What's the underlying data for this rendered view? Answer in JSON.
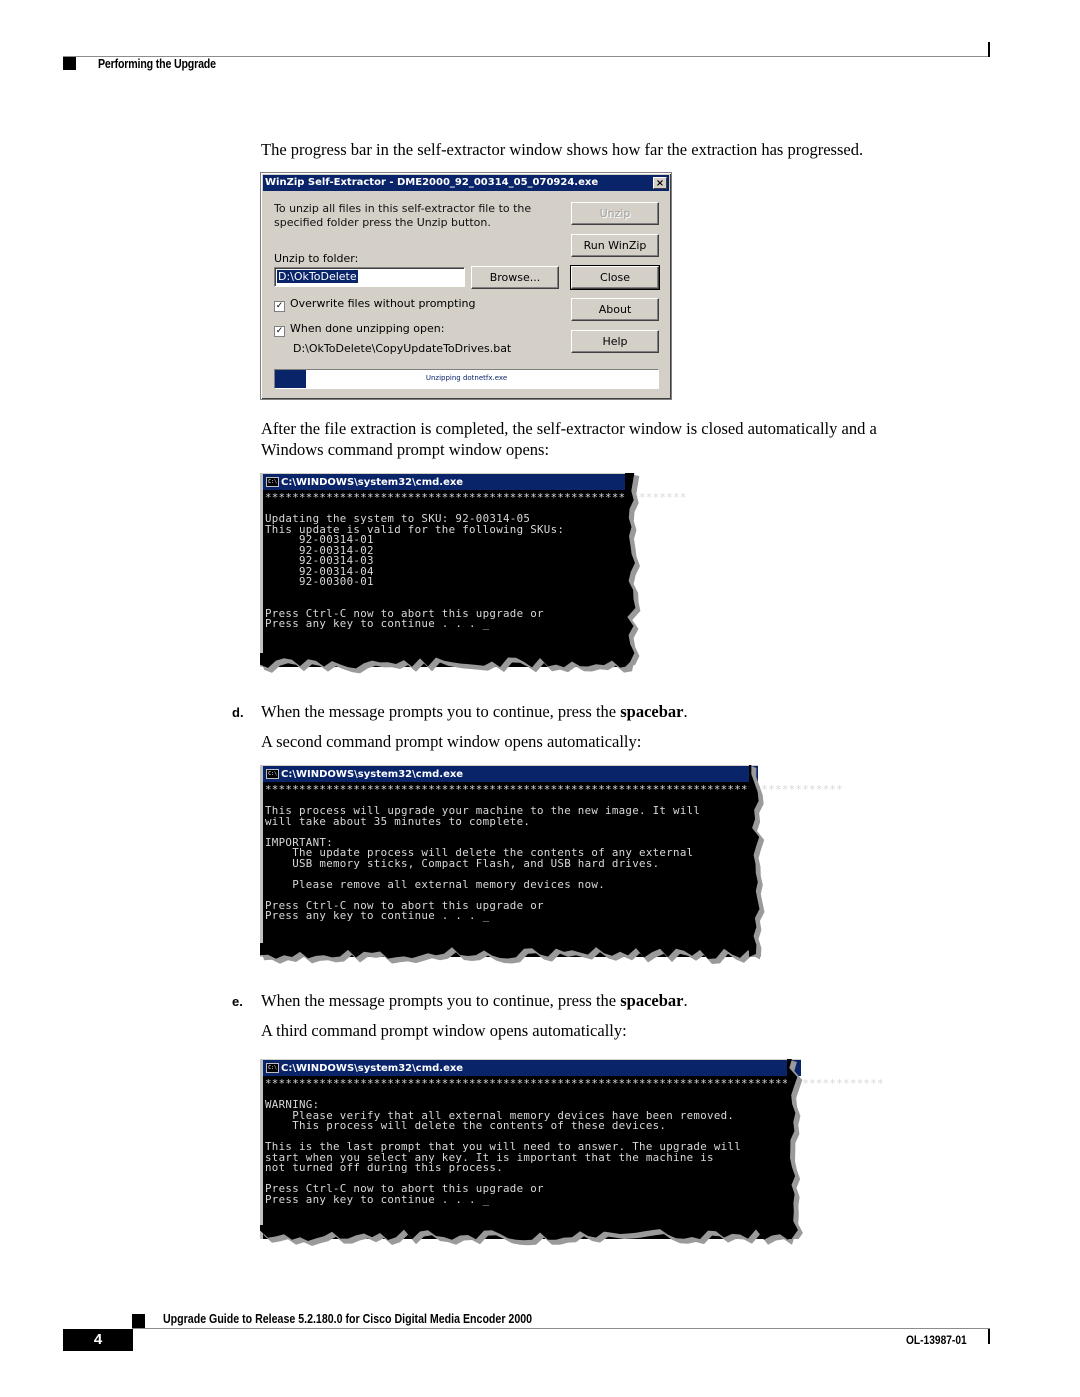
{
  "header": {
    "section_title": "Performing the Upgrade"
  },
  "intro_paragraph": "The progress bar in the self-extractor window shows how far the extraction has progressed.",
  "winzip_dialog": {
    "title": "WinZip Self-Extractor - DME2000_92_00314_05_070924.exe",
    "close_glyph": "×",
    "instruction_line1": "To unzip all files in this self-extractor file to the",
    "instruction_line2": "specified folder press the Unzip button.",
    "folder_label": "Unzip to folder:",
    "folder_value": "D:\\OkToDelete",
    "browse_label": "Browse...",
    "buttons": {
      "unzip": "Unzip",
      "run_winzip": "Run WinZip",
      "close": "Close",
      "about": "About",
      "help": "Help"
    },
    "overwrite_label": "Overwrite files without prompting",
    "overwrite_checked": true,
    "when_done_label": "When done unzipping open:",
    "when_done_checked": true,
    "check_glyph": "✓",
    "open_path": "D:\\OkToDelete\\CopyUpdateToDrives.bat",
    "progress_text": "Unzipping dotnetfx.exe",
    "progress_percent": 8,
    "colors": {
      "titlebar": "#0a246a",
      "face": "#d4d0c8"
    }
  },
  "after_extraction_paragraph_line1": "After the file extraction is completed, the self-extractor window is closed automatically and a",
  "after_extraction_paragraph_line2": "Windows command prompt window opens:",
  "cmd_window_1": {
    "title": "C:\\WINDOWS\\system32\\cmd.exe",
    "icon_text": "C:\\",
    "lines": [
      "**************************************************************",
      "",
      "Updating the system to SKU: 92-00314-05",
      "This update is valid for the following SKUs:",
      "     92-00314-01",
      "     92-00314-02",
      "     92-00314-03",
      "     92-00314-04",
      "     92-00300-01",
      "",
      "",
      "Press Ctrl-C now to abort this upgrade or",
      "Press any key to continue . . . _"
    ]
  },
  "step_d": {
    "label": "d.",
    "text_before": "When the message prompts you to continue, press the ",
    "bold": "spacebar",
    "text_after": ".",
    "followup": "A second command prompt window opens automatically:"
  },
  "cmd_window_2": {
    "title": "C:\\WINDOWS\\system32\\cmd.exe",
    "icon_text": "C:\\",
    "lines": [
      "*************************************************************************************",
      "",
      "This process will upgrade your machine to the new image. It will",
      "will take about 35 minutes to complete.",
      "",
      "IMPORTANT:",
      "    The update process will delete the contents of any external",
      "    USB memory sticks, Compact Flash, and USB hard drives.",
      "",
      "    Please remove all external memory devices now.",
      "",
      "Press Ctrl-C now to abort this upgrade or",
      "Press any key to continue . . . _"
    ]
  },
  "step_e": {
    "label": "e.",
    "text_before": "When the message prompts you to continue, press the ",
    "bold": "spacebar",
    "text_after": ".",
    "followup": "A third command prompt window opens automatically:"
  },
  "cmd_window_3": {
    "title": "C:\\WINDOWS\\system32\\cmd.exe",
    "icon_text": "C:\\",
    "lines": [
      "*******************************************************************************************",
      "",
      "WARNING:",
      "    Please verify that all external memory devices have been removed.",
      "    This process will delete the contents of these devices.",
      "",
      "This is the last prompt that you will need to answer. The upgrade will",
      "start when you select any key. It is important that the machine is",
      "not turned off during this process.",
      "",
      "Press Ctrl-C now to abort this upgrade or",
      "Press any key to continue . . . _"
    ]
  },
  "footer": {
    "guide_title": "Upgrade Guide to Release 5.2.180.0 for Cisco Digital Media Encoder 2000",
    "page_number": "4",
    "doc_number": "OL-13987-01"
  }
}
